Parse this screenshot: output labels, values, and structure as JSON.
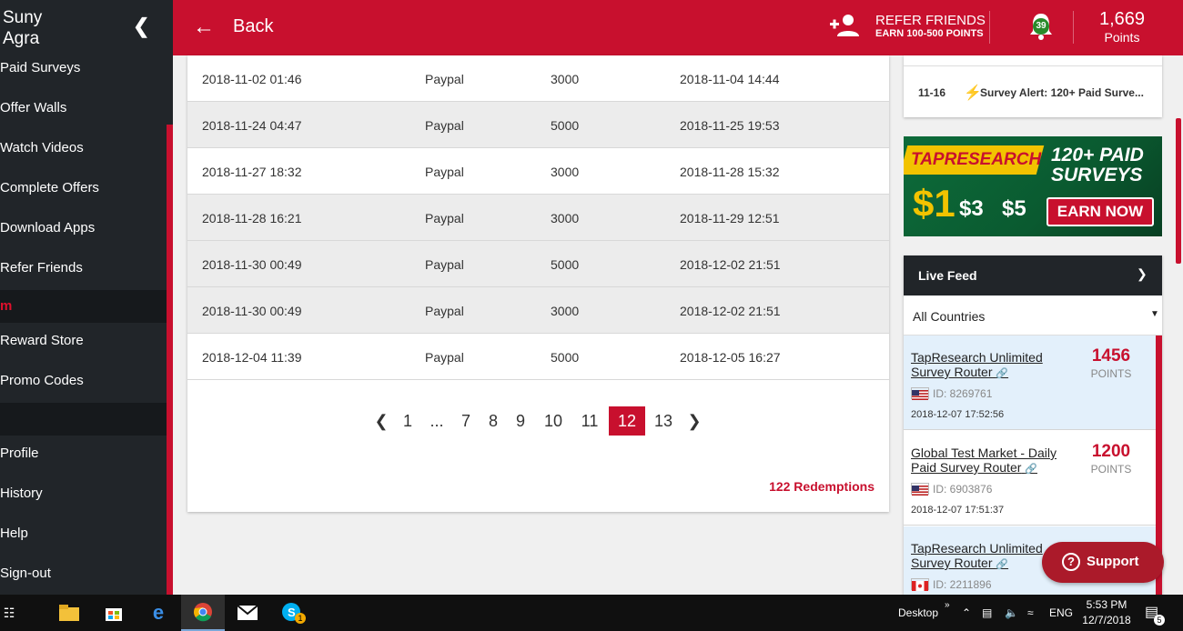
{
  "sidebar": {
    "user_first": "Suny",
    "user_last": "Agra",
    "items": [
      {
        "label": "Paid Surveys"
      },
      {
        "label": "Offer Walls"
      },
      {
        "label": "Watch Videos"
      },
      {
        "label": "Complete Offers"
      },
      {
        "label": "Download Apps"
      },
      {
        "label": "Refer Friends"
      },
      {
        "label": "m"
      },
      {
        "label": "Reward Store"
      },
      {
        "label": "Promo Codes"
      },
      {
        "label": "Profile"
      },
      {
        "label": "History"
      },
      {
        "label": "Help"
      },
      {
        "label": "Sign-out"
      }
    ]
  },
  "header": {
    "back_label": "Back",
    "refer_title": "REFER FRIENDS",
    "refer_sub": "EARN 100-500 POINTS",
    "notifications": "39",
    "points_value": "1,669",
    "points_label": "Points",
    "accent_color": "#c8102e"
  },
  "table": {
    "rows": [
      [
        "2018-11-02 01:46",
        "Paypal",
        "3000",
        "2018-11-04 14:44"
      ],
      [
        "2018-11-24 04:47",
        "Paypal",
        "5000",
        "2018-11-25 19:53"
      ],
      [
        "2018-11-27 18:32",
        "Paypal",
        "3000",
        "2018-11-28 15:32"
      ],
      [
        "2018-11-28 16:21",
        "Paypal",
        "3000",
        "2018-11-29 12:51"
      ],
      [
        "2018-11-30 00:49",
        "Paypal",
        "5000",
        "2018-12-02 21:51"
      ],
      [
        "2018-11-30 00:49",
        "Paypal",
        "3000",
        "2018-12-02 21:51"
      ],
      [
        "2018-12-04 11:39",
        "Paypal",
        "5000",
        "2018-12-05 16:27"
      ]
    ],
    "pager": [
      "1",
      "...",
      "7",
      "8",
      "9",
      "10",
      "11",
      "12",
      "13"
    ],
    "current_page": "12",
    "redemptions": "122 Redemptions"
  },
  "alert": {
    "date": "11-16",
    "text": "Survey Alert: 120+ Paid Surve..."
  },
  "banner": {
    "brand": "TAPRESEARCH",
    "headline": "120+ PAID SURVEYS",
    "amount1": "$1",
    "amount2": "$3",
    "amount3": "$5",
    "cta": "EARN NOW"
  },
  "live_feed": {
    "title": "Live Feed",
    "filter": "All Countries",
    "items": [
      {
        "name": "TapResearch Unlimited Survey Router",
        "points": "1456",
        "points_label": "POINTS",
        "id": "ID: 8269761",
        "time": "2018-12-07 17:52:56",
        "flag": "us"
      },
      {
        "name": "Global Test Market - Daily Paid Survey Router",
        "points": "1200",
        "points_label": "POINTS",
        "id": "ID: 6903876",
        "time": "2018-12-07 17:51:37",
        "flag": "us"
      },
      {
        "name": "TapResearch Unlimited Survey Router",
        "points": "",
        "points_label": "",
        "id": "ID: 2211896",
        "time": "",
        "flag": "ca"
      }
    ]
  },
  "support": {
    "label": "Support"
  },
  "taskbar": {
    "desktop": "Desktop",
    "lang": "ENG",
    "time": "5:53 PM",
    "date": "12/7/2018",
    "notif_count": "5",
    "skype_badge": "1"
  }
}
